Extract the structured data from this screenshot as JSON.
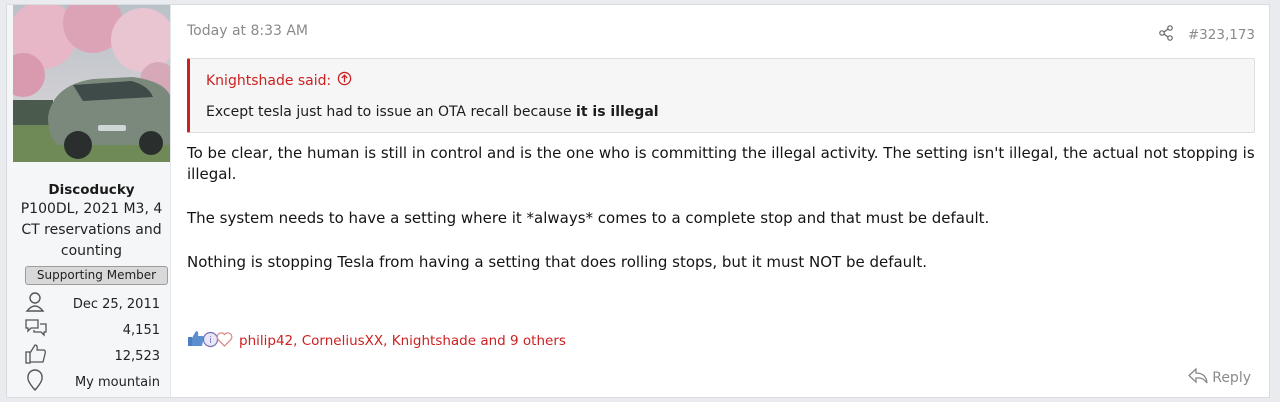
{
  "user": {
    "name": "Discoducky",
    "title": "P100DL, 2021 M3, 4 CT reservations and counting",
    "banner": "Supporting Member",
    "joined": "Dec 25, 2011",
    "messages": "4,151",
    "reaction_score": "12,523",
    "location": "My mountain"
  },
  "post": {
    "time": "Today at 8:33 AM",
    "number": "#323,173",
    "quote": {
      "author": "Knightshade said:",
      "text_before": "Except tesla just had to issue an OTA recall because ",
      "text_bold": "it is illegal"
    },
    "paragraphs": [
      "To be clear, the human is still in control and is the one who is committing the illegal activity. The setting isn't illegal, the actual not stopping is illegal.",
      "The system needs to have a setting where it *always* comes to a complete stop and that must be default.",
      "Nothing is stopping Tesla from having a setting that does rolling stops, but it must NOT be default."
    ],
    "reactions_text": "philip42, CorneliusXX, Knightshade and 9 others",
    "reply_label": "Reply"
  },
  "colors": {
    "accent": "#cc2121",
    "muted": "#8a8a8a"
  },
  "icons": [
    "person-icon",
    "chat-bubbles-icon",
    "thumbs-up-icon",
    "location-pin-icon",
    "share-icon",
    "arrow-up-circle-icon",
    "like-reaction-icon",
    "info-reaction-icon",
    "love-reaction-icon",
    "reply-arrow-icon"
  ]
}
